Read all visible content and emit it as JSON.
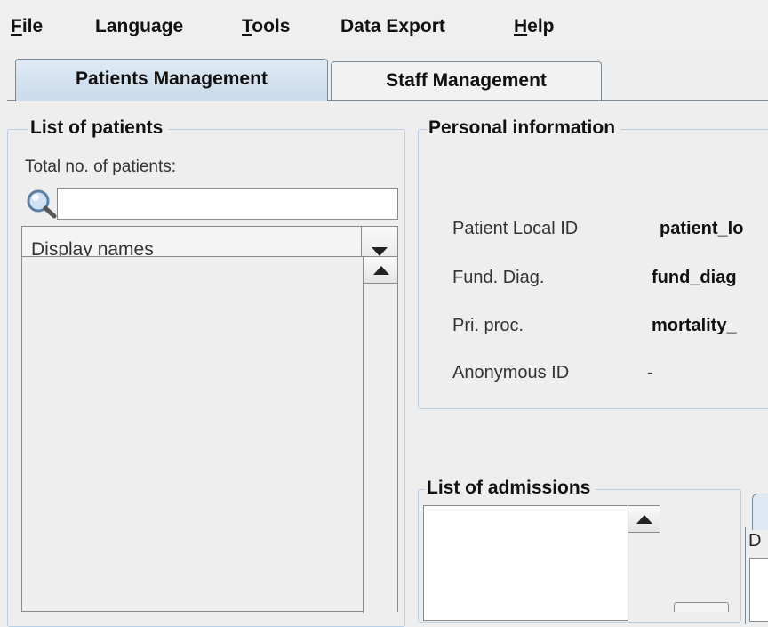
{
  "menu": {
    "file": {
      "mnemonic": "F",
      "rest": "ile"
    },
    "language": "Language",
    "tools": {
      "mnemonic": "T",
      "rest": "ools"
    },
    "data_export": "Data Export",
    "help": {
      "mnemonic": "H",
      "rest": "elp"
    }
  },
  "tabs": [
    {
      "label": "Patients Management",
      "active": true
    },
    {
      "label": "Staff Management",
      "active": false
    }
  ],
  "patients_panel": {
    "title": "List of patients",
    "total_label": "Total no. of patients:",
    "search_value": "",
    "display_combo_value": "Display names"
  },
  "personal_info": {
    "title": "Personal information",
    "rows": [
      {
        "label": "Patient Local ID",
        "value": "patient_lo"
      },
      {
        "label": "Fund. Diag.",
        "value": "fund_diag"
      },
      {
        "label": "Pri. proc.",
        "value": "mortality_"
      },
      {
        "label": "Anonymous ID",
        "value": "-"
      }
    ]
  },
  "admissions": {
    "title": "List of admissions",
    "right_partial_text": "D"
  },
  "colors": {
    "accent_tab": "#c9daea",
    "group_border": "#b8cfe5"
  }
}
